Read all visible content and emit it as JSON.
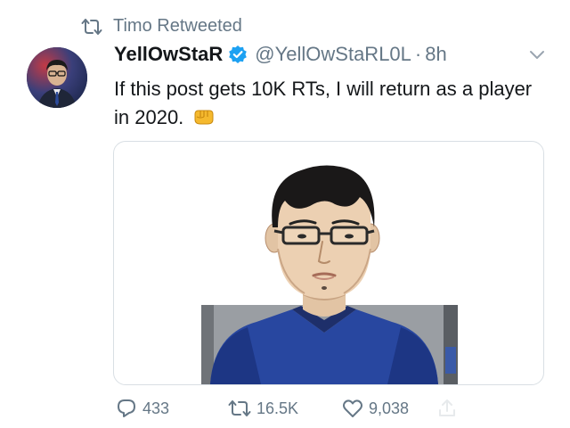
{
  "retweet_context": {
    "icon": "retweet-icon",
    "label": "Timo Retweeted"
  },
  "author": {
    "display_name": "YellOwStaR",
    "verified_icon": "verified-badge-icon",
    "handle": "@YellOwStaRL0L",
    "separator": "·",
    "time": "8h"
  },
  "menu": {
    "icon": "chevron-down-icon"
  },
  "tweet": {
    "text": "If this post gets 10K RTs, I will return as a player in 2020.",
    "emoji": "oncoming-fist-emoji"
  },
  "actions": {
    "reply_count": "433",
    "retweet_count": "16.5K",
    "like_count": "9,038"
  },
  "colors": {
    "muted": "#657786",
    "verified": "#1da1f2",
    "text": "#14171a"
  }
}
